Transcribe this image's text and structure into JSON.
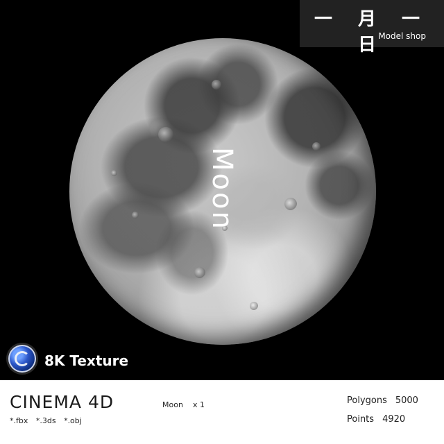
{
  "brand": {
    "title": "一 月 一 日",
    "subtitle": "Model shop"
  },
  "hero": {
    "label": "Moon"
  },
  "badge": {
    "texture": "8K Texture"
  },
  "info": {
    "software": "CINEMA 4D",
    "formats": "*.fbx   *.3ds   *.obj",
    "object_name": "Moon",
    "object_count": "x 1",
    "polygons_label": "Polygons",
    "polygons_value": "5000",
    "points_label": "Points",
    "points_value": "4920"
  },
  "colors": {
    "background": "#000000",
    "brand_box": "#222222",
    "info_bar": "#ffffff"
  },
  "icons": [
    "moon-image",
    "cinema4d-logo-icon"
  ]
}
